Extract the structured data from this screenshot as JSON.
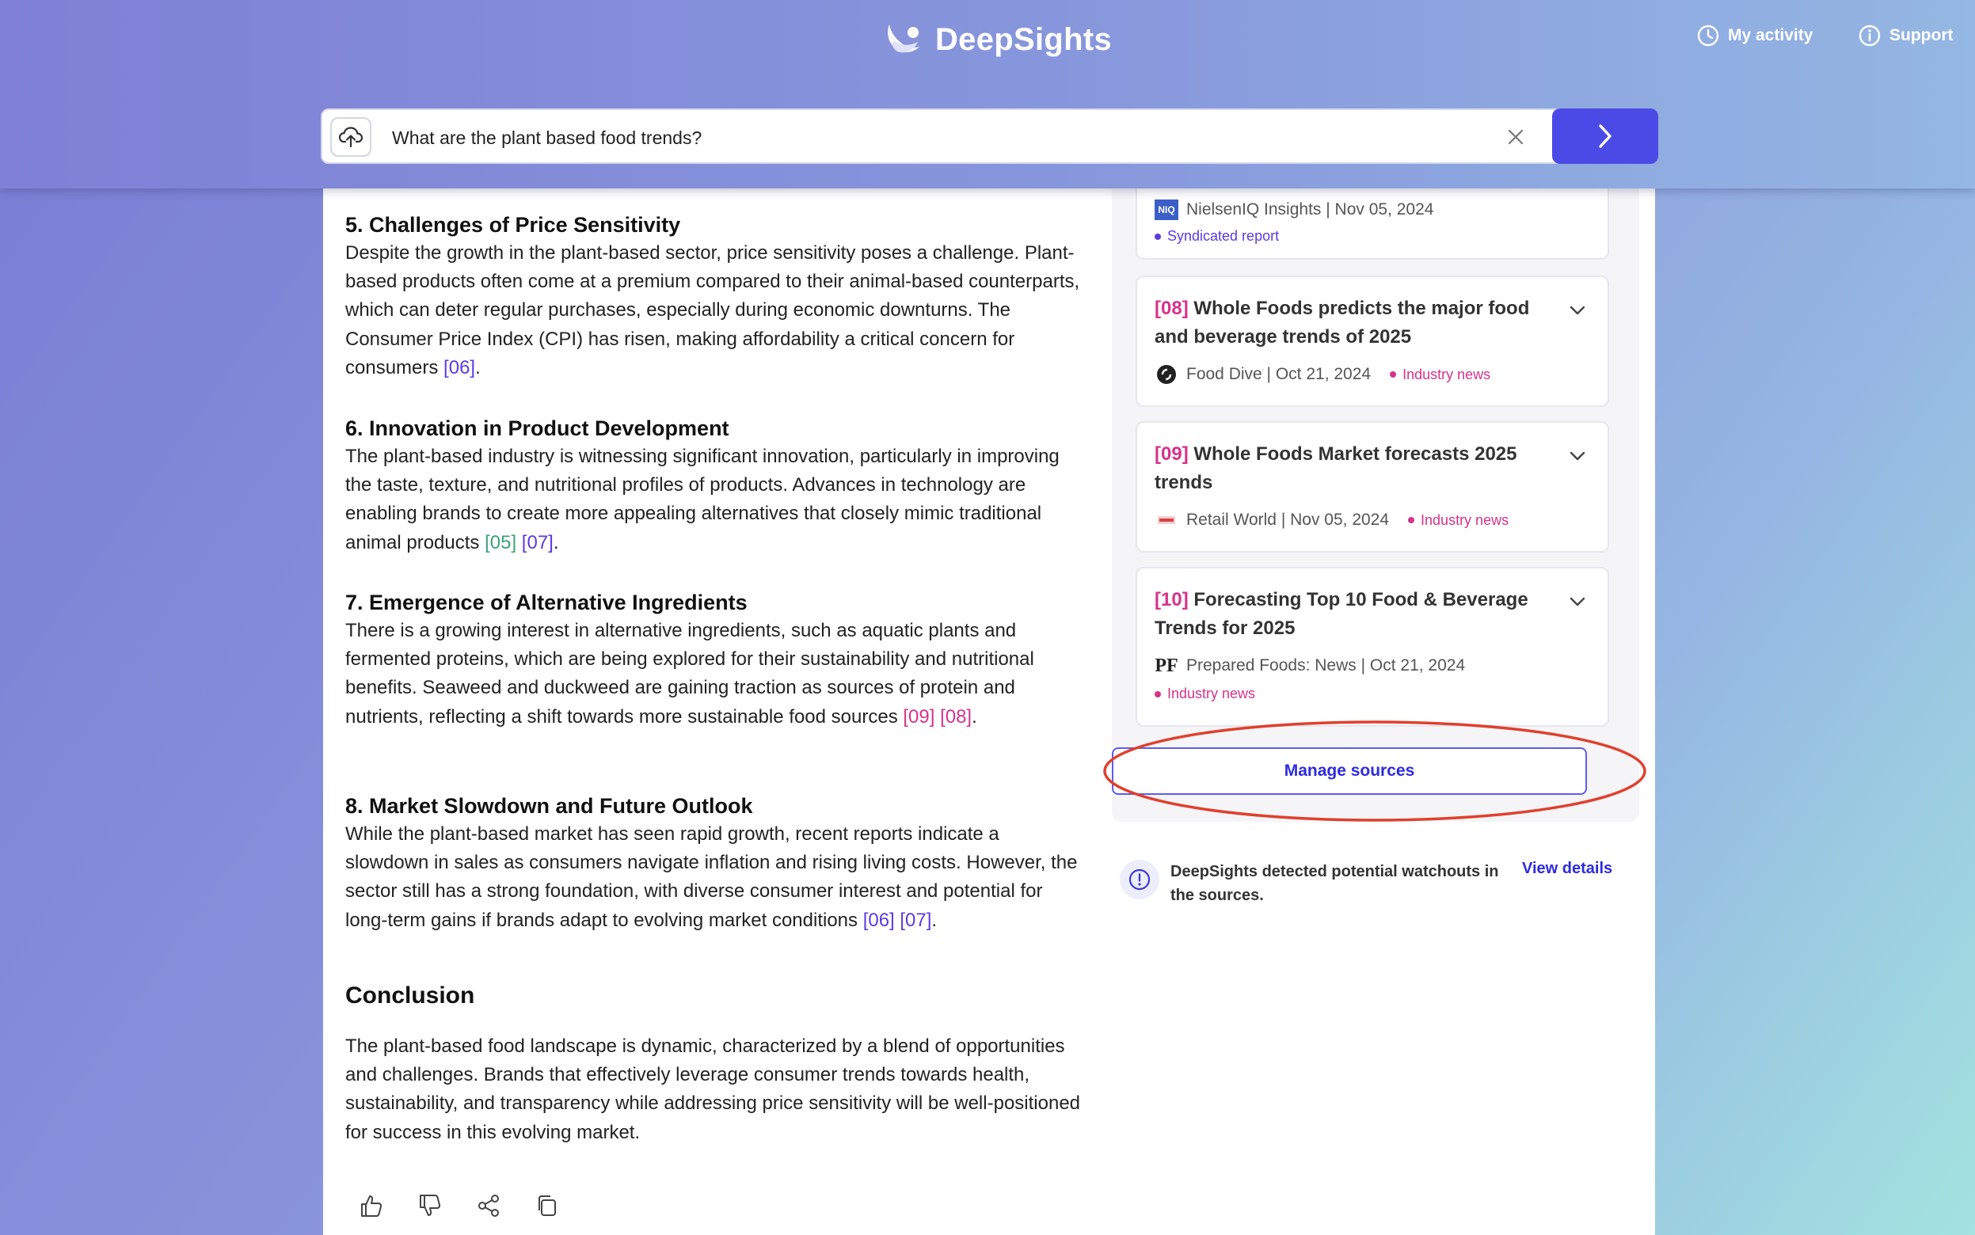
{
  "header": {
    "logo_text": "DeepSights",
    "my_activity": "My activity",
    "support": "Support"
  },
  "search": {
    "value": "What are the plant based food trends?"
  },
  "article": {
    "sections": [
      {
        "title": "5. Challenges of Price Sensitivity",
        "text": "Despite the growth in the plant-based sector, price sensitivity poses a challenge. Plant-based products often come at a premium compared to their animal-based counterparts, which can deter regular purchases, especially during economic downturns. The Consumer Price Index (CPI) has risen, making affordability a critical concern for consumers",
        "citations": [
          "[06]"
        ]
      },
      {
        "title": "6. Innovation in Product Development",
        "text": "The plant-based industry is witnessing significant innovation, particularly in improving the taste, texture, and nutritional profiles of products. Advances in technology are enabling brands to create more appealing alternatives that closely mimic traditional animal products",
        "citations": [
          "[05]",
          "[07]"
        ]
      },
      {
        "title": "7. Emergence of Alternative Ingredients",
        "text": "There is a growing interest in alternative ingredients, such as aquatic plants and fermented proteins, which are being explored for their sustainability and nutritional benefits. Seaweed and duckweed are gaining traction as sources of protein and nutrients, reflecting a shift towards more sustainable food sources",
        "citations": [
          "[09]",
          "[08]"
        ]
      },
      {
        "title": "8. Market Slowdown and Future Outlook",
        "text": "While the plant-based market has seen rapid growth, recent reports indicate a slowdown in sales as consumers navigate inflation and rising living costs. However, the sector still has a strong foundation, with diverse consumer interest and potential for long-term gains if brands adapt to evolving market conditions",
        "citations": [
          "[06]",
          "[07]"
        ]
      }
    ],
    "conclusion_title": "Conclusion",
    "conclusion_text": "The plant-based food landscape is dynamic, characterized by a blend of opportunities and challenges. Brands that effectively leverage consumer trends towards health, sustainability, and transparency while addressing price sensitivity will be well-positioned for success in this evolving market."
  },
  "sources": {
    "partial_card": {
      "source": "NielsenIQ Insights | Nov 05, 2024",
      "logo_text": "NIQ",
      "tag": "Syndicated report"
    },
    "cards": [
      {
        "num": "[08]",
        "title": "Whole Foods predicts the major food and beverage trends of 2025",
        "source": "Food Dive | Oct 21, 2024",
        "tag": "Industry news"
      },
      {
        "num": "[09]",
        "title": "Whole Foods Market forecasts 2025 trends",
        "source": "Retail World | Nov 05, 2024",
        "tag": "Industry news"
      },
      {
        "num": "[10]",
        "title": "Forecasting Top 10 Food & Beverage Trends for 2025",
        "source": "Prepared Foods: News | Oct 21, 2024",
        "logo_text": "PF",
        "tag": "Industry news"
      }
    ],
    "manage_label": "Manage sources"
  },
  "watchout": {
    "text": "DeepSights detected potential watchouts in the sources.",
    "link": "View details"
  },
  "colors": {
    "accent": "#4b4ae6",
    "citation_purple": "#5a3be0",
    "citation_pink": "#d6338a",
    "citation_green": "#3aa27a",
    "syndicated_tag": "#5a3be0",
    "industry_tag": "#d6338a",
    "annotation_red": "#e0402c"
  }
}
